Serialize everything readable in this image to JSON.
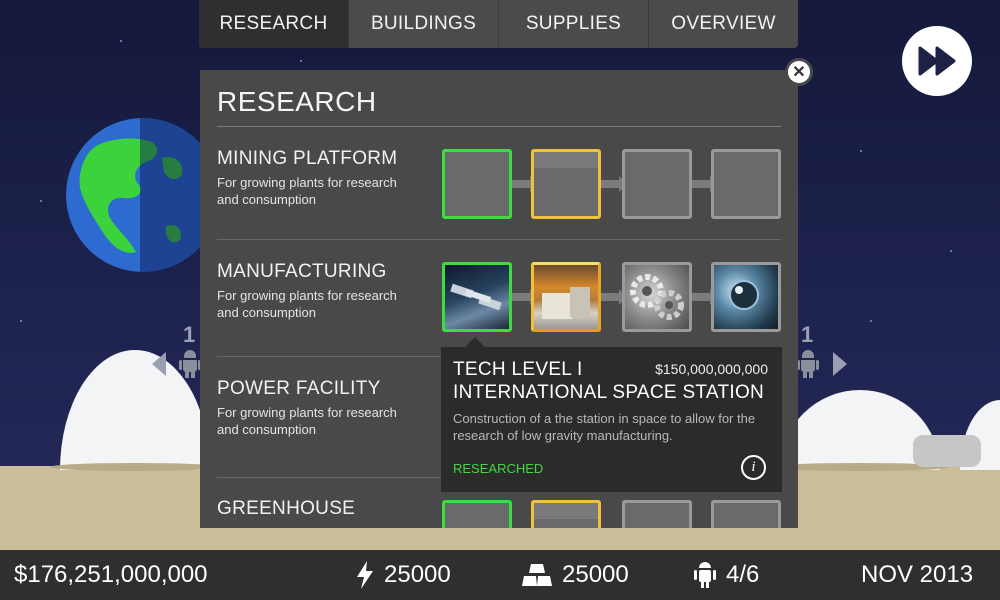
{
  "tabs": [
    {
      "label": "RESEARCH",
      "active": true
    },
    {
      "label": "BUILDINGS",
      "active": false
    },
    {
      "label": "SUPPLIES",
      "active": false
    },
    {
      "label": "OVERVIEW",
      "active": false
    }
  ],
  "panel": {
    "title": "RESEARCH",
    "categories": [
      {
        "name": "MINING PLATFORM",
        "desc": "For growing plants for research and consumption"
      },
      {
        "name": "MANUFACTURING",
        "desc": "For growing plants for research and consumption"
      },
      {
        "name": "POWER FACILITY",
        "desc": "For growing plants for research and consumption"
      },
      {
        "name": "GREENHOUSE",
        "desc": ""
      }
    ]
  },
  "tooltip": {
    "level": "TECH LEVEL I",
    "cost": "$150,000,000,000",
    "name": "INTERNATIONAL SPACE STATION",
    "description": "Construction of a the station in space to allow for the research of low gravity manufacturing.",
    "status": "RESEARCHED"
  },
  "side": {
    "left_count": "1",
    "right_count": "1"
  },
  "status_bar": {
    "money": "$176,251,000,000",
    "power": "25000",
    "materials": "25000",
    "robots": "4/6",
    "date": "NOV 2013"
  },
  "colors": {
    "researched_border": "#3fdc3f",
    "available_border": "#f0c23a",
    "locked_border": "#9a9a9a",
    "status_green": "#42d842"
  }
}
